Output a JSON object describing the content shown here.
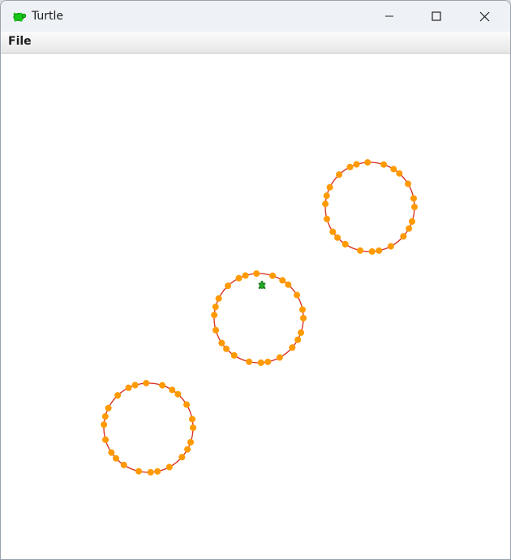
{
  "window": {
    "title": "Turtle"
  },
  "menubar": {
    "items": [
      {
        "label": "File"
      }
    ]
  },
  "canvas": {
    "background": "#ffffff",
    "pen_color": "#d62a1a",
    "dot_color": "#ff9a00",
    "turtle_color": "#23b223",
    "circles": [
      {
        "name": "upper-right-circle",
        "dots": 24
      },
      {
        "name": "middle-circle",
        "dots": 24
      },
      {
        "name": "lower-left-circle",
        "dots": 24
      }
    ]
  },
  "icons": {
    "app": "turtle-icon",
    "minimize": "minimize-icon",
    "maximize": "maximize-icon",
    "close": "close-icon",
    "cursor": "turtle-cursor-icon"
  }
}
